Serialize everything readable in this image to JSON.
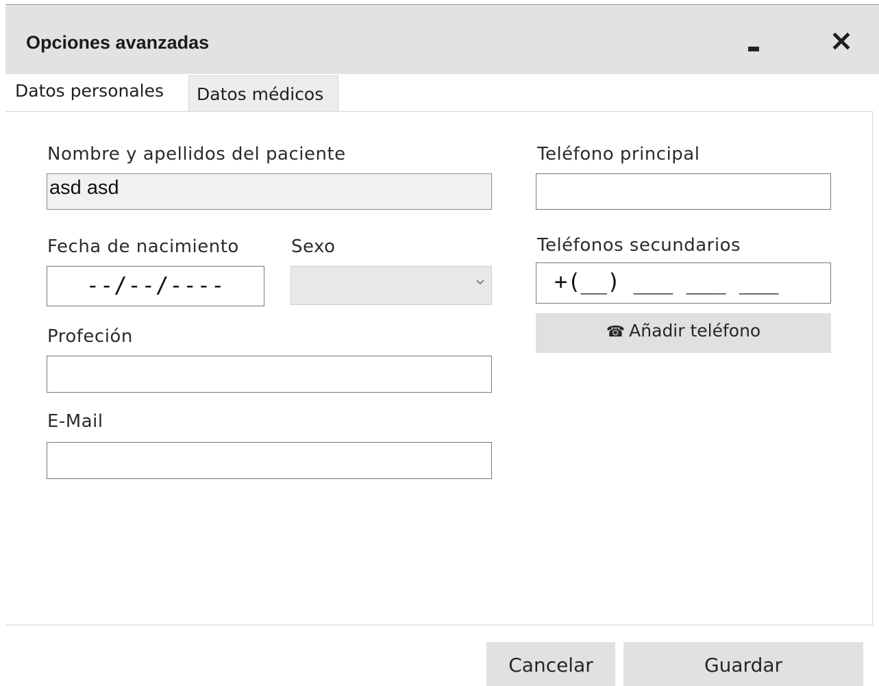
{
  "window": {
    "title": "Opciones avanzadas"
  },
  "tabs": [
    {
      "label": "Datos personales",
      "active": true
    },
    {
      "label": "Datos médicos",
      "active": false
    }
  ],
  "form": {
    "name": {
      "label": "Nombre y apellidos del paciente",
      "value": "asd asd"
    },
    "birthdate": {
      "label": "Fecha de nacimiento",
      "value": "--/--/----"
    },
    "sex": {
      "label": "Sexo",
      "value": ""
    },
    "profession": {
      "label": "Profeción",
      "value": ""
    },
    "email": {
      "label": "E-Mail",
      "value": ""
    },
    "main_phone": {
      "label": "Teléfono principal",
      "value": ""
    },
    "secondary_phones": {
      "label": "Teléfonos secundarios",
      "value": "+(__) ___ ___ ___"
    },
    "add_phone_label": "Añadir teléfono"
  },
  "icons": {
    "add_phone": "telephone-icon",
    "minimize": "minimize-icon",
    "close": "close-icon",
    "select": "chevron-down-icon"
  },
  "footer": {
    "cancel_label": "Cancelar",
    "save_label": "Guardar"
  },
  "colors": {
    "titlebar": "#e2e2e2",
    "button": "#e1e1e1",
    "readonly_field": "#f1f1f1"
  }
}
